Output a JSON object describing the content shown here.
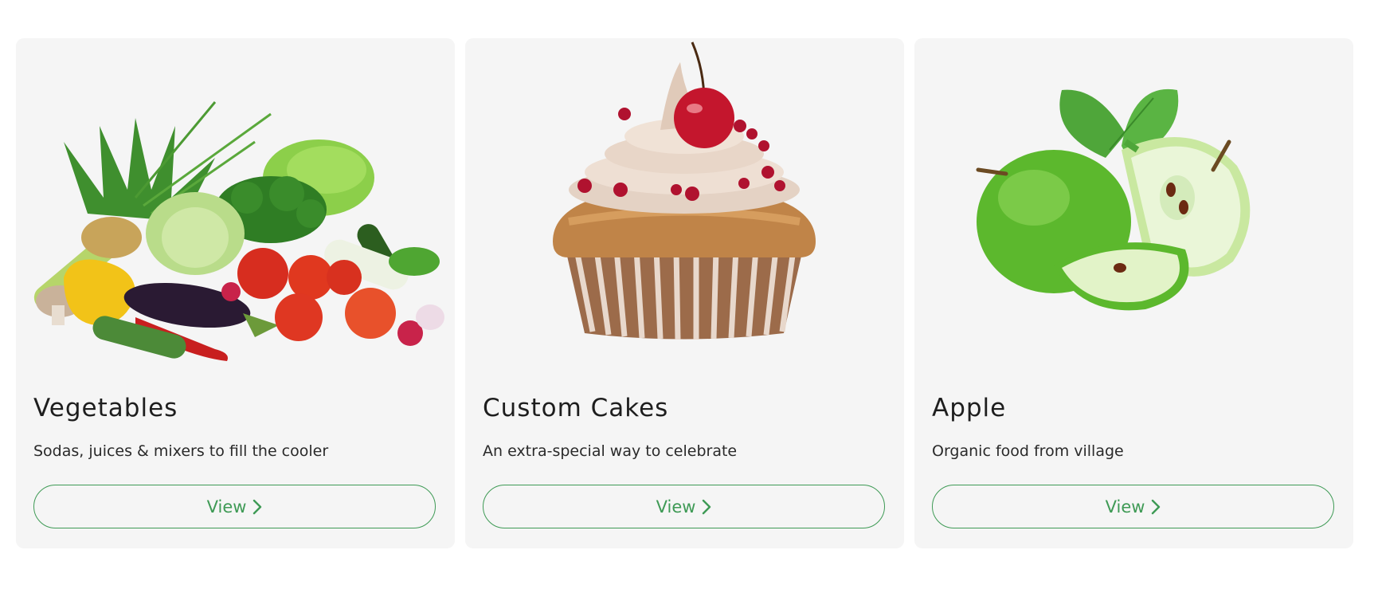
{
  "accent_color": "#3e9a55",
  "cards": [
    {
      "title": "Vegetables",
      "description": "Sodas, juices & mixers to fill the cooler",
      "button_label": "View",
      "image": "vegetables-image"
    },
    {
      "title": "Custom Cakes",
      "description": "An extra-special way to celebrate",
      "button_label": "View",
      "image": "cupcake-image"
    },
    {
      "title": "Apple",
      "description": "Organic food from village",
      "button_label": "View",
      "image": "apple-image"
    }
  ]
}
